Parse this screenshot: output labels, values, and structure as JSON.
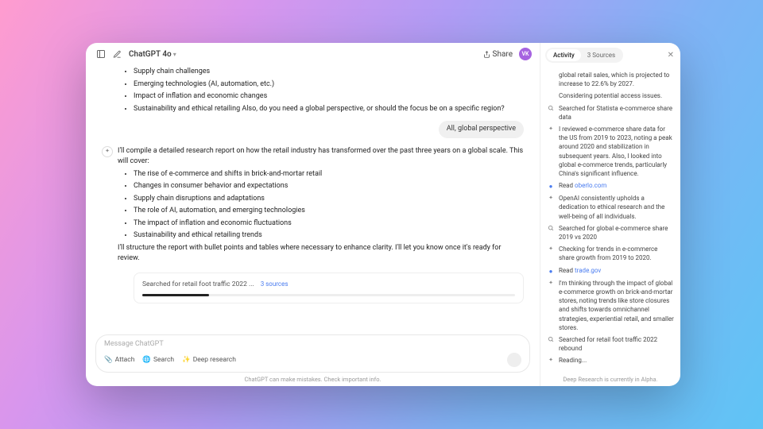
{
  "topbar": {
    "title": "ChatGPT 4o",
    "share": "Share",
    "avatar": "VK"
  },
  "chat": {
    "prelist": [
      "Supply chain challenges",
      "Emerging technologies (AI, automation, etc.)",
      "Impact of inflation and economic changes",
      "Sustainability and ethical retailing Also, do you need a global perspective, or should the focus be on a specific region?"
    ],
    "user": "All, global perspective",
    "intro": "I'll compile a detailed research report on how the retail industry has transformed over the past three years on a global scale. This will cover:",
    "bullets": [
      "The rise of e-commerce and shifts in brick-and-mortar retail",
      "Changes in consumer behavior and expectations",
      "Supply chain disruptions and adaptations",
      "The role of AI, automation, and emerging technologies",
      "The impact of inflation and economic fluctuations",
      "Sustainability and ethical retailing trends"
    ],
    "outro": "I'll structure the report with bullet points and tables where necessary to enhance clarity. I'll let you know once it's ready for review.",
    "status": {
      "text": "Searched for retail foot traffic 2022 ...",
      "sources": "3 sources"
    }
  },
  "composer": {
    "placeholder": "Message ChatGPT",
    "attach": "Attach",
    "search": "Search",
    "deep": "Deep research"
  },
  "footer_left": "ChatGPT can make mistakes. Check important info.",
  "panel": {
    "tab_activity": "Activity",
    "tab_sources": "3 Sources",
    "items": [
      {
        "icon": "",
        "text": "global retail sales, which is projected to increase to 22.6% by 2027."
      },
      {
        "icon": "",
        "text": "Considering potential access issues."
      },
      {
        "icon": "search",
        "text": "Searched for Statista e-commerce share data"
      },
      {
        "icon": "think",
        "text": "I reviewed e-commerce share data for the US from 2019 to 2023, noting a peak around 2020 and stabilization in subsequent years. Also, I looked into global e-commerce trends, particularly China's significant influence."
      },
      {
        "icon": "read",
        "pre": "Read ",
        "link": "oberlo.com"
      },
      {
        "icon": "think",
        "text": "OpenAI consistently upholds a dedication to ethical research and the well-being of all individuals."
      },
      {
        "icon": "search",
        "text": "Searched for global e-commerce share 2019 vs 2020"
      },
      {
        "icon": "think",
        "text": "Checking for trends in e-commerce share growth from 2019 to 2020."
      },
      {
        "icon": "read",
        "pre": "Read ",
        "link": "trade.gov"
      },
      {
        "icon": "think",
        "text": "I'm thinking through the impact of global e-commerce growth on brick-and-mortar stores, noting trends like store closures and shifts towards omnichannel strategies, experiential retail, and smaller stores."
      },
      {
        "icon": "search",
        "text": "Searched for retail foot traffic 2022 rebound"
      },
      {
        "icon": "think",
        "text": "Reading..."
      }
    ],
    "footer": "Deep Research is currently in Alpha."
  }
}
